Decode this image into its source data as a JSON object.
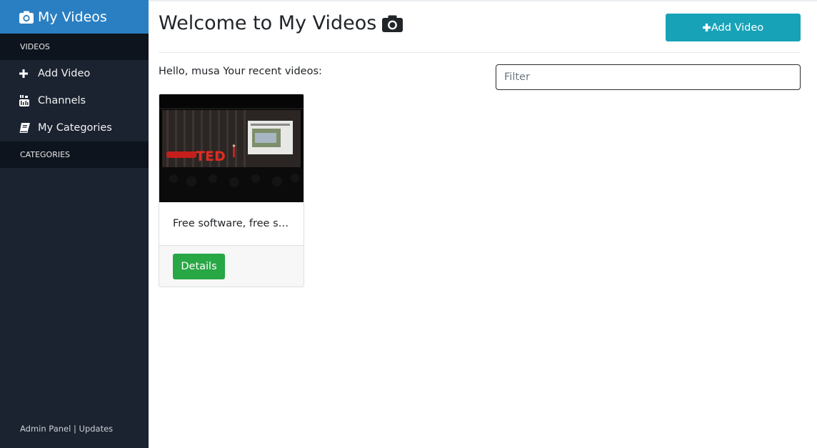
{
  "sidebar": {
    "brand_label": "My Videos",
    "section_videos": "VIDEOS",
    "items": [
      {
        "label": "Add Video",
        "icon": "plus-icon"
      },
      {
        "label": "Channels",
        "icon": "youtube-icon"
      },
      {
        "label": "My Categories",
        "icon": "book-icon"
      }
    ],
    "section_categories": "CATEGORIES",
    "footer": {
      "admin": "Admin Panel",
      "separator": " | ",
      "updates": "Updates"
    }
  },
  "main": {
    "title": "Welcome to My Videos",
    "add_button_label": "Add Video",
    "greeting": "Hello, musa Your recent videos:",
    "filter_placeholder": "Filter",
    "videos": [
      {
        "title": "Free software, free s…",
        "thumbnail_stage_text": "TED",
        "details_label": "Details"
      }
    ]
  },
  "colors": {
    "sidebar_bg": "#1b2330",
    "brand_bg": "#2a7fc2",
    "section_bg": "#0e141d",
    "add_button": "#17a2b8",
    "details_button": "#28a745"
  }
}
